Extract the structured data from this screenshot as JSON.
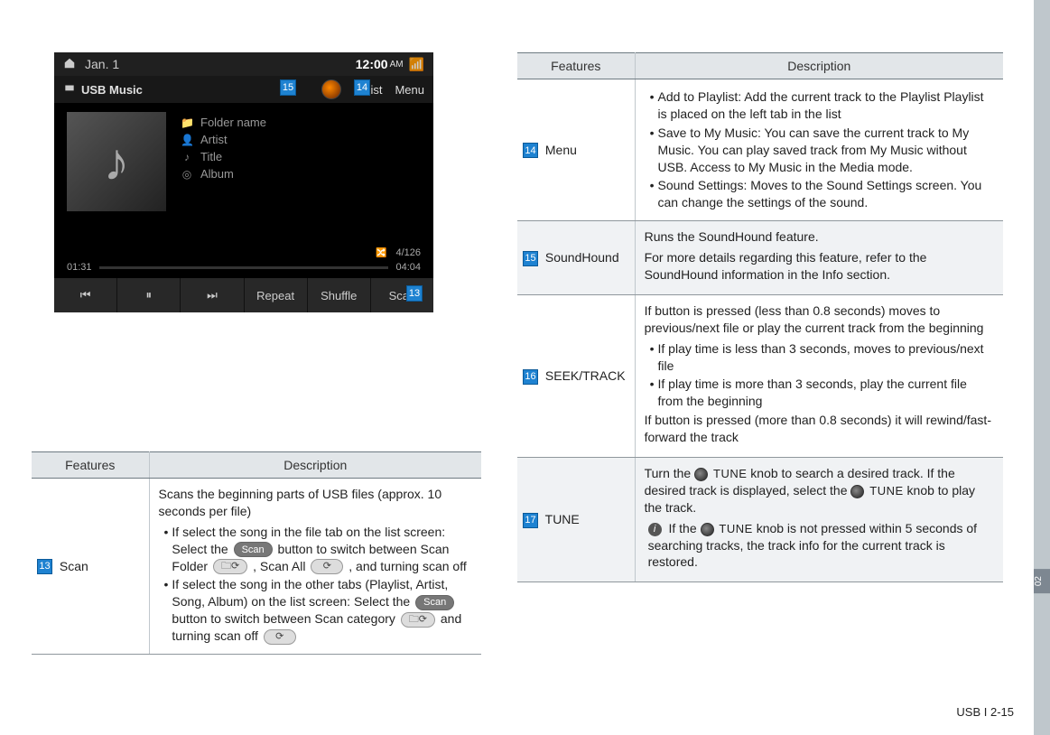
{
  "page": {
    "footer": "USB I 2-15",
    "chapterTab": "02"
  },
  "screenshot": {
    "date": "Jan. 1",
    "time": "12:00",
    "ampm": "AM",
    "sourceLabel": "USB Music",
    "listLabel": "List",
    "menuLabel": "Menu",
    "meta": {
      "folder": "Folder name",
      "artist": "Artist",
      "title": "Title",
      "album": "Album"
    },
    "trackCount": "4/126",
    "elapsed": "01:31",
    "total": "04:04",
    "controls": {
      "prev": "⏮",
      "pause": "⏸",
      "next": "⏭",
      "repeat": "Repeat",
      "shuffle": "Shuffle",
      "scan": "Scan"
    }
  },
  "callouts": {
    "c13": "13",
    "c14": "14",
    "c15": "15",
    "c16": "16",
    "c17": "17"
  },
  "leftTable": {
    "headerFeatures": "Features",
    "headerDescription": "Description",
    "rows": [
      {
        "num": "13",
        "feature": "Scan",
        "descIntro": "Scans the beginning parts of USB files (approx. 10 seconds per file)",
        "bullet1_a": "If select the song in the file tab on the list screen: Select the ",
        "bullet1_btn": "Scan",
        "bullet1_b": " button to switch between Scan Folder ",
        "bullet1_c": ", Scan All ",
        "bullet1_d": ", and turning scan off",
        "bullet2_a": "If select the song in the other tabs (Playlist, Artist, Song, Album) on the list screen: Select the ",
        "bullet2_btn": "Scan",
        "bullet2_b": " button to switch between Scan category ",
        "bullet2_c": " and turning scan off "
      }
    ]
  },
  "rightTable": {
    "headerFeatures": "Features",
    "headerDescription": "Description",
    "rows": [
      {
        "num": "14",
        "feature": "Menu",
        "b1": "Add to Playlist: Add the current track to the Playlist Playlist is placed on the left tab in the list",
        "b2": "Save to My Music: You can save the current track to My Music. You can play saved track from My Music without USB.  Access to My Music in the Media mode.",
        "b3": "Sound Settings: Moves to the Sound Settings screen. You can change the settings of the sound."
      },
      {
        "num": "15",
        "feature": "SoundHound",
        "p1": "Runs the SoundHound feature.",
        "p2": "For more details regarding this feature, refer to the SoundHound information in the Info section."
      },
      {
        "num": "16",
        "feature": "SEEK/TRACK",
        "p1": "If button is pressed (less than 0.8 seconds) moves to previous/next file or play the current track from the beginning",
        "b1": "If play time is less than 3 seconds, moves to previous/next file",
        "b2": "If play time is more than 3 seconds, play the current file from the beginning",
        "p2": "If button is pressed (more than 0.8 seconds) it will rewind/fast-forward the track"
      },
      {
        "num": "17",
        "feature": "TUNE",
        "tune_a": "Turn the ",
        "tune_knob1": "TUNE",
        "tune_b": " knob to search a desired track. If the desired track is displayed, select the ",
        "tune_knob2": "TUNE",
        "tune_c": " knob to play the track.",
        "info_a": "If the ",
        "info_knob": "TUNE",
        "info_b": " knob is not pressed within 5 seconds of searching tracks, the track info for the current track is restored."
      }
    ]
  }
}
